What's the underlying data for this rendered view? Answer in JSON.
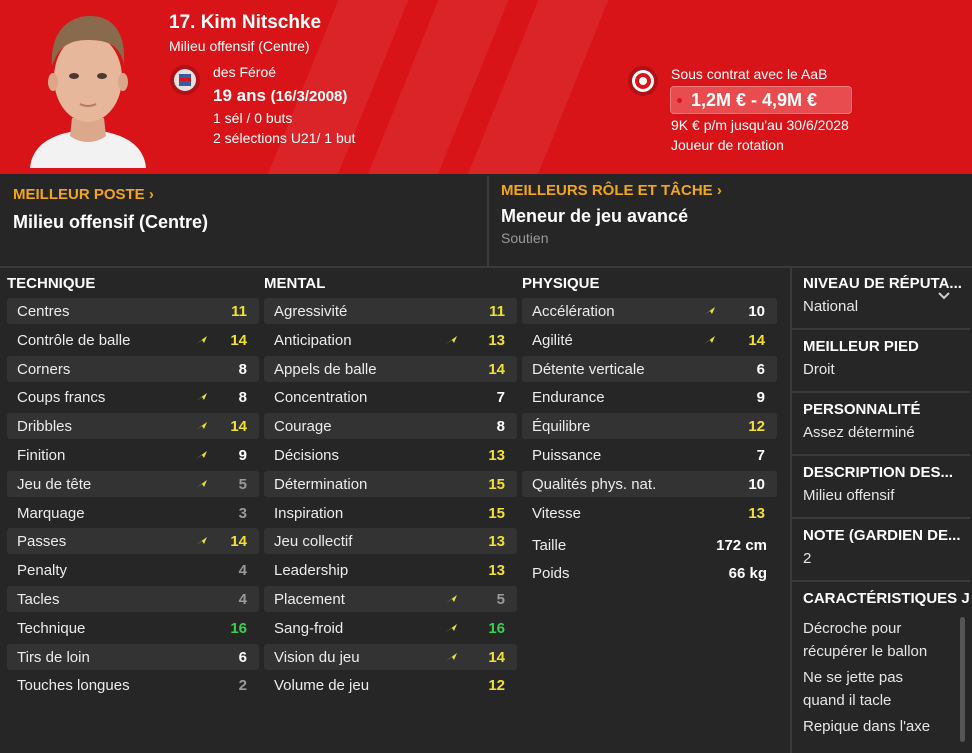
{
  "header": {
    "player_name": "17. Kim Nitschke",
    "position": "Milieu offensif (Centre)",
    "nation": "des Féroé",
    "age": "19 ans",
    "dob": "(16/3/2008)",
    "caps_senior": "1 sél / 0 buts",
    "caps_u21": "2 sélections U21/ 1 but",
    "contract": "Sous contrat avec le AaB",
    "value_range": "1,2M € - 4,9M €",
    "wage": "9K € p/m jusqu'au 30/6/2028",
    "squad_status": "Joueur de rotation",
    "accent_color": "#d81418"
  },
  "best_position": {
    "title": "MEILLEUR POSTE",
    "value": "Milieu offensif (Centre)"
  },
  "best_role": {
    "title": "MEILLEURS RÔLE ET TÂCHE",
    "value": "Meneur de jeu avancé",
    "duty": "Soutien"
  },
  "technical": {
    "title": "TECHNIQUE",
    "attributes": [
      {
        "name": "Centres",
        "value": "11",
        "color": "yellow",
        "arrow": false
      },
      {
        "name": "Contrôle de balle",
        "value": "14",
        "color": "yellow",
        "arrow": true
      },
      {
        "name": "Corners",
        "value": "8",
        "color": "white",
        "arrow": false
      },
      {
        "name": "Coups francs",
        "value": "8",
        "color": "white",
        "arrow": true
      },
      {
        "name": "Dribbles",
        "value": "14",
        "color": "yellow",
        "arrow": true
      },
      {
        "name": "Finition",
        "value": "9",
        "color": "white",
        "arrow": true
      },
      {
        "name": "Jeu de tête",
        "value": "5",
        "color": "grey",
        "arrow": true
      },
      {
        "name": "Marquage",
        "value": "3",
        "color": "grey",
        "arrow": false
      },
      {
        "name": "Passes",
        "value": "14",
        "color": "yellow",
        "arrow": true
      },
      {
        "name": "Penalty",
        "value": "4",
        "color": "grey",
        "arrow": false
      },
      {
        "name": "Tacles",
        "value": "4",
        "color": "grey",
        "arrow": false
      },
      {
        "name": "Technique",
        "value": "16",
        "color": "green",
        "arrow": false
      },
      {
        "name": "Tirs de loin",
        "value": "6",
        "color": "white",
        "arrow": false
      },
      {
        "name": "Touches longues",
        "value": "2",
        "color": "grey",
        "arrow": false
      }
    ]
  },
  "mental": {
    "title": "MENTAL",
    "attributes": [
      {
        "name": "Agressivité",
        "value": "11",
        "color": "yellow",
        "arrow": false
      },
      {
        "name": "Anticipation",
        "value": "13",
        "color": "yellow",
        "arrow": true
      },
      {
        "name": "Appels de balle",
        "value": "14",
        "color": "yellow",
        "arrow": false
      },
      {
        "name": "Concentration",
        "value": "7",
        "color": "white",
        "arrow": false
      },
      {
        "name": "Courage",
        "value": "8",
        "color": "white",
        "arrow": false
      },
      {
        "name": "Décisions",
        "value": "13",
        "color": "yellow",
        "arrow": false
      },
      {
        "name": "Détermination",
        "value": "15",
        "color": "yellow",
        "arrow": false
      },
      {
        "name": "Inspiration",
        "value": "15",
        "color": "yellow",
        "arrow": false
      },
      {
        "name": "Jeu collectif",
        "value": "13",
        "color": "yellow",
        "arrow": false
      },
      {
        "name": "Leadership",
        "value": "13",
        "color": "yellow",
        "arrow": false
      },
      {
        "name": "Placement",
        "value": "5",
        "color": "grey",
        "arrow": true
      },
      {
        "name": "Sang-froid",
        "value": "16",
        "color": "green",
        "arrow": true
      },
      {
        "name": "Vision du jeu",
        "value": "14",
        "color": "yellow",
        "arrow": true
      },
      {
        "name": "Volume de jeu",
        "value": "12",
        "color": "yellow",
        "arrow": false
      }
    ]
  },
  "physical": {
    "title": "PHYSIQUE",
    "attributes": [
      {
        "name": "Accélération",
        "value": "10",
        "color": "white",
        "arrow": true
      },
      {
        "name": "Agilité",
        "value": "14",
        "color": "yellow",
        "arrow": true
      },
      {
        "name": "Détente verticale",
        "value": "6",
        "color": "white",
        "arrow": false
      },
      {
        "name": "Endurance",
        "value": "9",
        "color": "white",
        "arrow": false
      },
      {
        "name": "Équilibre",
        "value": "12",
        "color": "yellow",
        "arrow": false
      },
      {
        "name": "Puissance",
        "value": "7",
        "color": "white",
        "arrow": false
      },
      {
        "name": "Qualités phys. nat.",
        "value": "10",
        "color": "white",
        "arrow": false
      },
      {
        "name": "Vitesse",
        "value": "13",
        "color": "yellow",
        "arrow": false
      }
    ],
    "height_label": "Taille",
    "height_value": "172 cm",
    "weight_label": "Poids",
    "weight_value": "66 kg"
  },
  "side_panel": {
    "reputation_title": "NIVEAU DE RÉPUTA...",
    "reputation_value": "National",
    "foot_title": "MEILLEUR PIED",
    "foot_value": "Droit",
    "personality_title": "PERSONNALITÉ",
    "personality_value": "Assez déterminé",
    "description_title": "DESCRIPTION DES...",
    "description_value": "Milieu offensif",
    "note_title": "NOTE (GARDIEN DE...",
    "note_value": "2",
    "traits_title": "CARACTÉRISTIQUES J",
    "traits": [
      "Décroche pour",
      "récupérer le ballon",
      "Ne se jette pas",
      "quand il tacle",
      "Repique dans l'axe"
    ]
  }
}
